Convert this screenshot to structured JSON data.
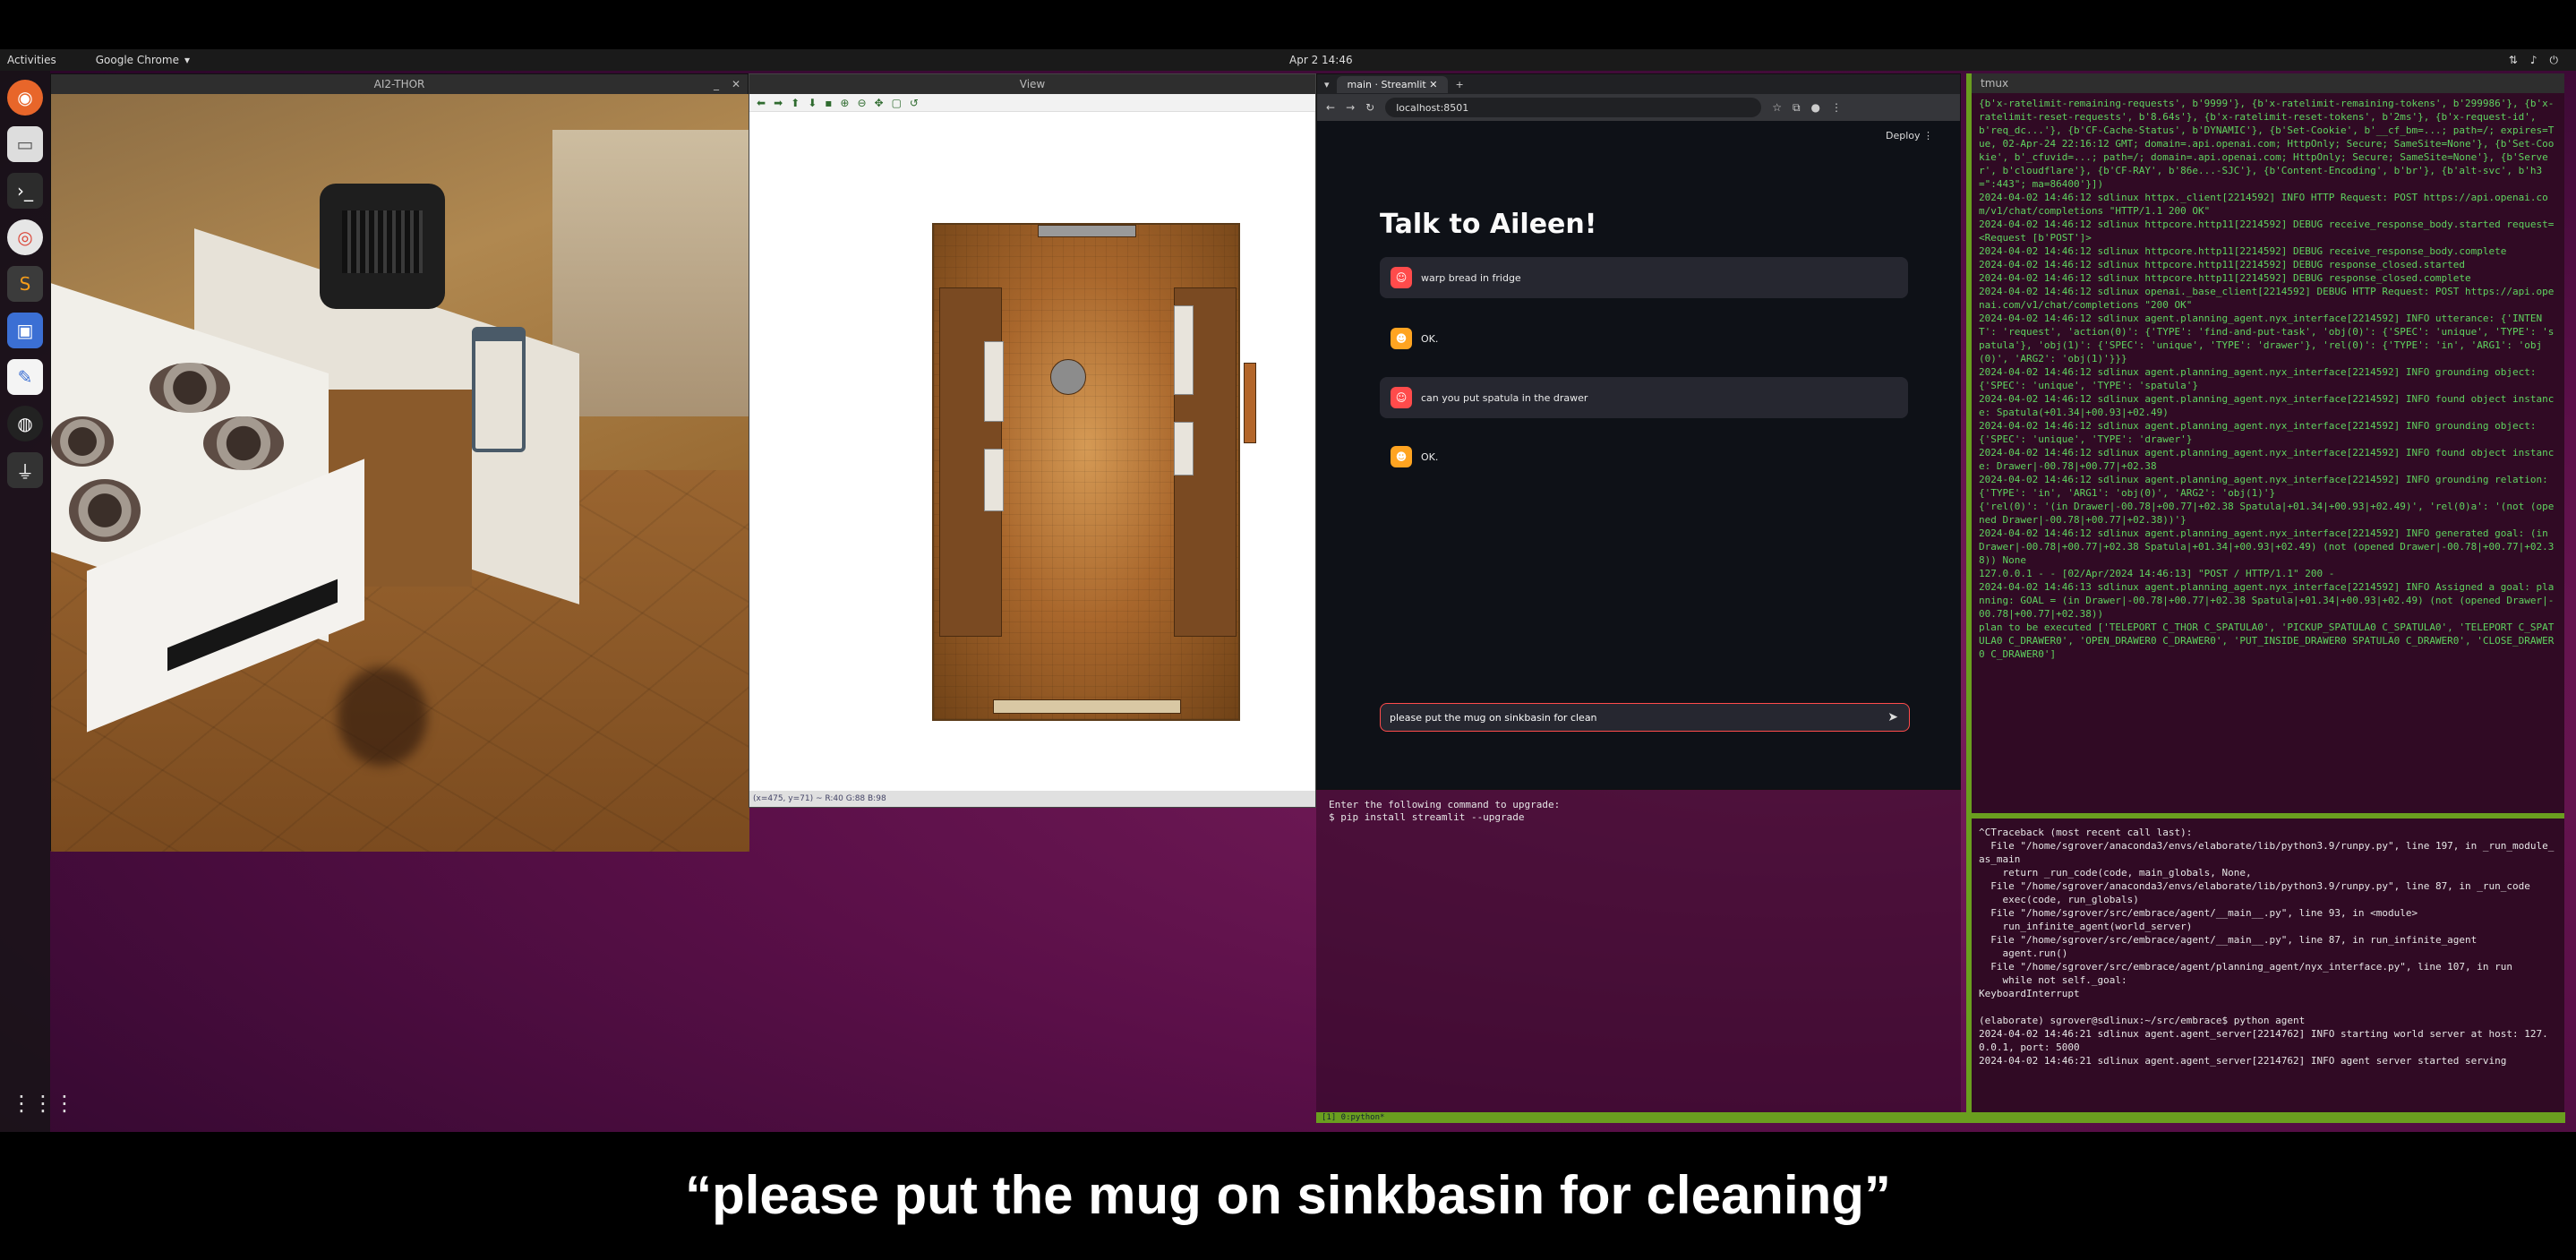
{
  "topbar": {
    "activities": "Activities",
    "app_name": "Google Chrome",
    "clock": "Apr 2  14:46"
  },
  "thor_window": {
    "title": "AI2-THOR"
  },
  "view_window": {
    "title": "View",
    "status": "(x=475, y=71) ~ R:40 G:88 B:98"
  },
  "chrome": {
    "tab_title": "main · Streamlit",
    "url": "localhost:8501",
    "deploy_label": "Deploy"
  },
  "streamlit": {
    "title": "Talk to Aileen!",
    "messages": [
      {
        "role": "user",
        "text": "warp bread in fridge"
      },
      {
        "role": "assistant",
        "text": "OK."
      },
      {
        "role": "user",
        "text": "can you put spatula in the drawer"
      },
      {
        "role": "assistant",
        "text": "OK."
      }
    ],
    "input_value": "please put the mug on sinkbasin for clean"
  },
  "term_left": {
    "text": "Enter the following command to upgrade:\n$ pip install streamlit --upgrade"
  },
  "rterm": {
    "title": "tmux",
    "log_top": "{b'x-ratelimit-remaining-requests', b'9999'}, {b'x-ratelimit-remaining-tokens', b'299986'}, {b'x-ratelimit-reset-requests', b'8.64s'}, {b'x-ratelimit-reset-tokens', b'2ms'}, {b'x-request-id', b'req_dc...'}, {b'CF-Cache-Status', b'DYNAMIC'}, {b'Set-Cookie', b'__cf_bm=...; path=/; expires=Tue, 02-Apr-24 22:16:12 GMT; domain=.api.openai.com; HttpOnly; Secure; SameSite=None'}, {b'Set-Cookie', b'_cfuvid=...; path=/; domain=.api.openai.com; HttpOnly; Secure; SameSite=None'}, {b'Server', b'cloudflare'}, {b'CF-RAY', b'86e...-SJC'}, {b'Content-Encoding', b'br'}, {b'alt-svc', b'h3=\":443\"; ma=86400'}])\n2024-04-02 14:46:12 sdlinux httpx._client[2214592] INFO HTTP Request: POST https://api.openai.com/v1/chat/completions \"HTTP/1.1 200 OK\"\n2024-04-02 14:46:12 sdlinux httpcore.http11[2214592] DEBUG receive_response_body.started request=<Request [b'POST']>\n2024-04-02 14:46:12 sdlinux httpcore.http11[2214592] DEBUG receive_response_body.complete\n2024-04-02 14:46:12 sdlinux httpcore.http11[2214592] DEBUG response_closed.started\n2024-04-02 14:46:12 sdlinux httpcore.http11[2214592] DEBUG response_closed.complete\n2024-04-02 14:46:12 sdlinux openai._base_client[2214592] DEBUG HTTP Request: POST https://api.openai.com/v1/chat/completions \"200 OK\"\n2024-04-02 14:46:12 sdlinux agent.planning_agent.nyx_interface[2214592] INFO utterance: {'INTENT': 'request', 'action(0)': {'TYPE': 'find-and-put-task', 'obj(0)': {'SPEC': 'unique', 'TYPE': 'spatula'}, 'obj(1)': {'SPEC': 'unique', 'TYPE': 'drawer'}, 'rel(0)': {'TYPE': 'in', 'ARG1': 'obj(0)', 'ARG2': 'obj(1)'}}}\n2024-04-02 14:46:12 sdlinux agent.planning_agent.nyx_interface[2214592] INFO grounding object: {'SPEC': 'unique', 'TYPE': 'spatula'}\n2024-04-02 14:46:12 sdlinux agent.planning_agent.nyx_interface[2214592] INFO found object instance: Spatula(+01.34|+00.93|+02.49)\n2024-04-02 14:46:12 sdlinux agent.planning_agent.nyx_interface[2214592] INFO grounding object: {'SPEC': 'unique', 'TYPE': 'drawer'}\n2024-04-02 14:46:12 sdlinux agent.planning_agent.nyx_interface[2214592] INFO found object instance: Drawer|-00.78|+00.77|+02.38\n2024-04-02 14:46:12 sdlinux agent.planning_agent.nyx_interface[2214592] INFO grounding relation: {'TYPE': 'in', 'ARG1': 'obj(0)', 'ARG2': 'obj(1)'}\n{'rel(0)': '(in Drawer|-00.78|+00.77|+02.38 Spatula|+01.34|+00.93|+02.49)', 'rel(0)a': '(not (opened Drawer|-00.78|+00.77|+02.38))'}\n2024-04-02 14:46:12 sdlinux agent.planning_agent.nyx_interface[2214592] INFO generated goal: (in Drawer|-00.78|+00.77|+02.38 Spatula|+01.34|+00.93|+02.49) (not (opened Drawer|-00.78|+00.77|+02.38)) None\n127.0.0.1 - - [02/Apr/2024 14:46:13] \"POST / HTTP/1.1\" 200 -\n2024-04-02 14:46:13 sdlinux agent.planning_agent.nyx_interface[2214592] INFO Assigned a goal: planning: GOAL = (in Drawer|-00.78|+00.77|+02.38 Spatula|+01.34|+00.93|+02.49) (not (opened Drawer|-00.78|+00.77|+02.38))\nplan to be executed ['TELEPORT C_THOR C_SPATULA0', 'PICKUP_SPATULA0 C_SPATULA0', 'TELEPORT C_SPATULA0 C_DRAWER0', 'OPEN_DRAWER0 C_DRAWER0', 'PUT_INSIDE_DRAWER0 SPATULA0 C_DRAWER0', 'CLOSE_DRAWER0 C_DRAWER0']",
    "log_bottom": "^CTraceback (most recent call last):\n  File \"/home/sgrover/anaconda3/envs/elaborate/lib/python3.9/runpy.py\", line 197, in _run_module_as_main\n    return _run_code(code, main_globals, None,\n  File \"/home/sgrover/anaconda3/envs/elaborate/lib/python3.9/runpy.py\", line 87, in _run_code\n    exec(code, run_globals)\n  File \"/home/sgrover/src/embrace/agent/__main__.py\", line 93, in <module>\n    run_infinite_agent(world_server)\n  File \"/home/sgrover/src/embrace/agent/__main__.py\", line 87, in run_infinite_agent\n    agent.run()\n  File \"/home/sgrover/src/embrace/agent/planning_agent/nyx_interface.py\", line 107, in run\n    while not self._goal:\nKeyboardInterrupt\n\n(elaborate) sgrover@sdlinux:~/src/embrace$ python agent\n2024-04-02 14:46:21 sdlinux agent.agent_server[2214762] INFO starting world server at host: 127.0.0.1, port: 5000\n2024-04-02 14:46:21 sdlinux agent.agent_server[2214762] INFO agent server started serving"
  },
  "tmux_status": "[1] 0:python*",
  "caption": "“please put the mug on sinkbasin for cleaning”",
  "colors": {
    "streamlit_bg": "#0e1117",
    "user_avatar": "#ff4b4b",
    "bot_avatar": "#ffa421",
    "terminal_bg": "#300a24",
    "tmux_green": "#6a9e1f"
  },
  "icons": [
    "firefox-icon",
    "files-icon",
    "terminal-icon",
    "chrome-icon",
    "sublime-icon",
    "screenshot-icon",
    "text-editor-icon",
    "obs-icon",
    "usb-icon",
    "app-grid-icon",
    "send-icon",
    "close-icon"
  ]
}
